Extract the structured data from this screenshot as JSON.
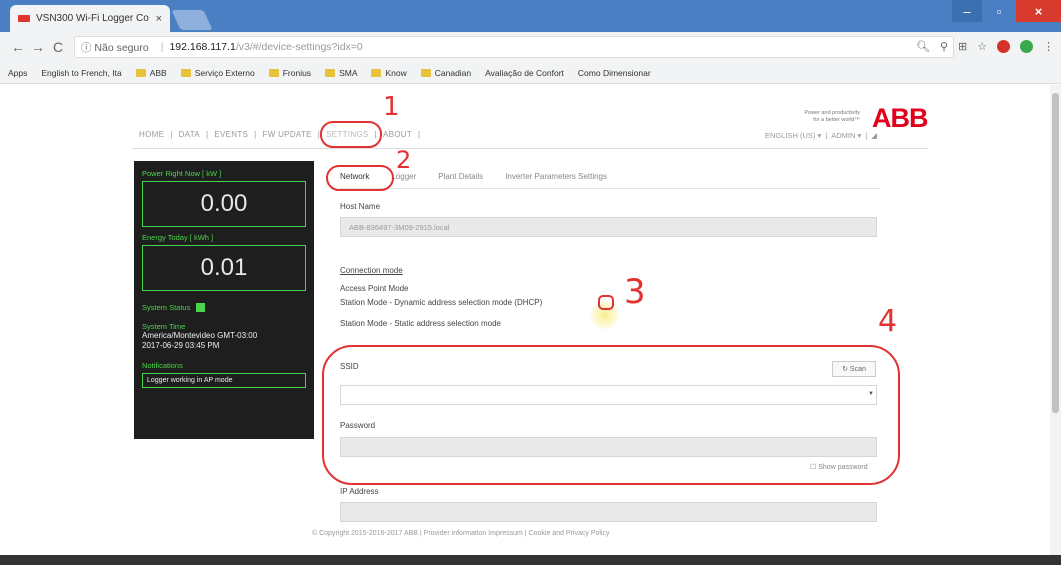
{
  "browser": {
    "tab_title": "VSN300 Wi-Fi Logger Co",
    "tab_close": "×",
    "window_min": "–",
    "window_max": "▫",
    "window_close": "×",
    "back": "←",
    "forward": "→",
    "reload": "C",
    "home": "⌂",
    "security": "ⓘ Não seguro",
    "url_host": "192.168.117.1",
    "url_path": "/v3/#/device-settings?idx=0",
    "bookmarks": [
      {
        "label": "Apps",
        "folder": false
      },
      {
        "label": "English to French, Ita",
        "folder": false
      },
      {
        "label": "ABB",
        "folder": true
      },
      {
        "label": "Serviço Externo",
        "folder": true
      },
      {
        "label": "Fronius",
        "folder": true
      },
      {
        "label": "SMA",
        "folder": true
      },
      {
        "label": "Know",
        "folder": true
      },
      {
        "label": "Canadian",
        "folder": true
      },
      {
        "label": "Avaliação de Confort",
        "folder": false
      },
      {
        "label": "Como Dimensionar",
        "folder": false
      }
    ]
  },
  "brand": {
    "tagline_1": "Power and productivity",
    "tagline_2": "for a better world™",
    "logo": "ABB"
  },
  "nav": {
    "items": [
      "HOME",
      "DATA",
      "EVENTS",
      "FW UPDATE",
      "SETTINGS",
      "ABOUT"
    ],
    "language": "ENGLISH (US) ▾",
    "user": "ADMIN ▾"
  },
  "panel": {
    "power_label": "Power Right Now [ kW ]",
    "power_value": "0.00",
    "energy_label": "Energy Today [ kWh ]",
    "energy_value": "0.01",
    "status_label": "System Status",
    "time_label": "System Time",
    "timezone": "America/Montevideo GMT-03:00",
    "datetime": "2017-06-29 03:45 PM",
    "notif_label": "Notifications",
    "notif_text": "Logger working in AP mode"
  },
  "tabs": [
    "Network",
    "Logger",
    "Plant Details",
    "Inverter Parameters Settings"
  ],
  "form": {
    "host_label": "Host Name",
    "host_value": "ABB-836497-3M09-2915.local",
    "mode_title": "Connection mode",
    "mode_ap": "Access Point Mode",
    "mode_dhcp": "Station Mode - Dynamic address selection mode (DHCP)",
    "mode_static": "Station Mode - Static address selection mode",
    "ssid_label": "SSID",
    "scan_label": "Scan",
    "password_label": "Password",
    "show_password": "Show password",
    "ip_label": "IP Address"
  },
  "footer": "© Copyright 2015-2016-2017 ABB | Provider information Impressum | Cookie and Privacy Policy",
  "annotations": [
    "1",
    "2",
    "3",
    "4"
  ]
}
